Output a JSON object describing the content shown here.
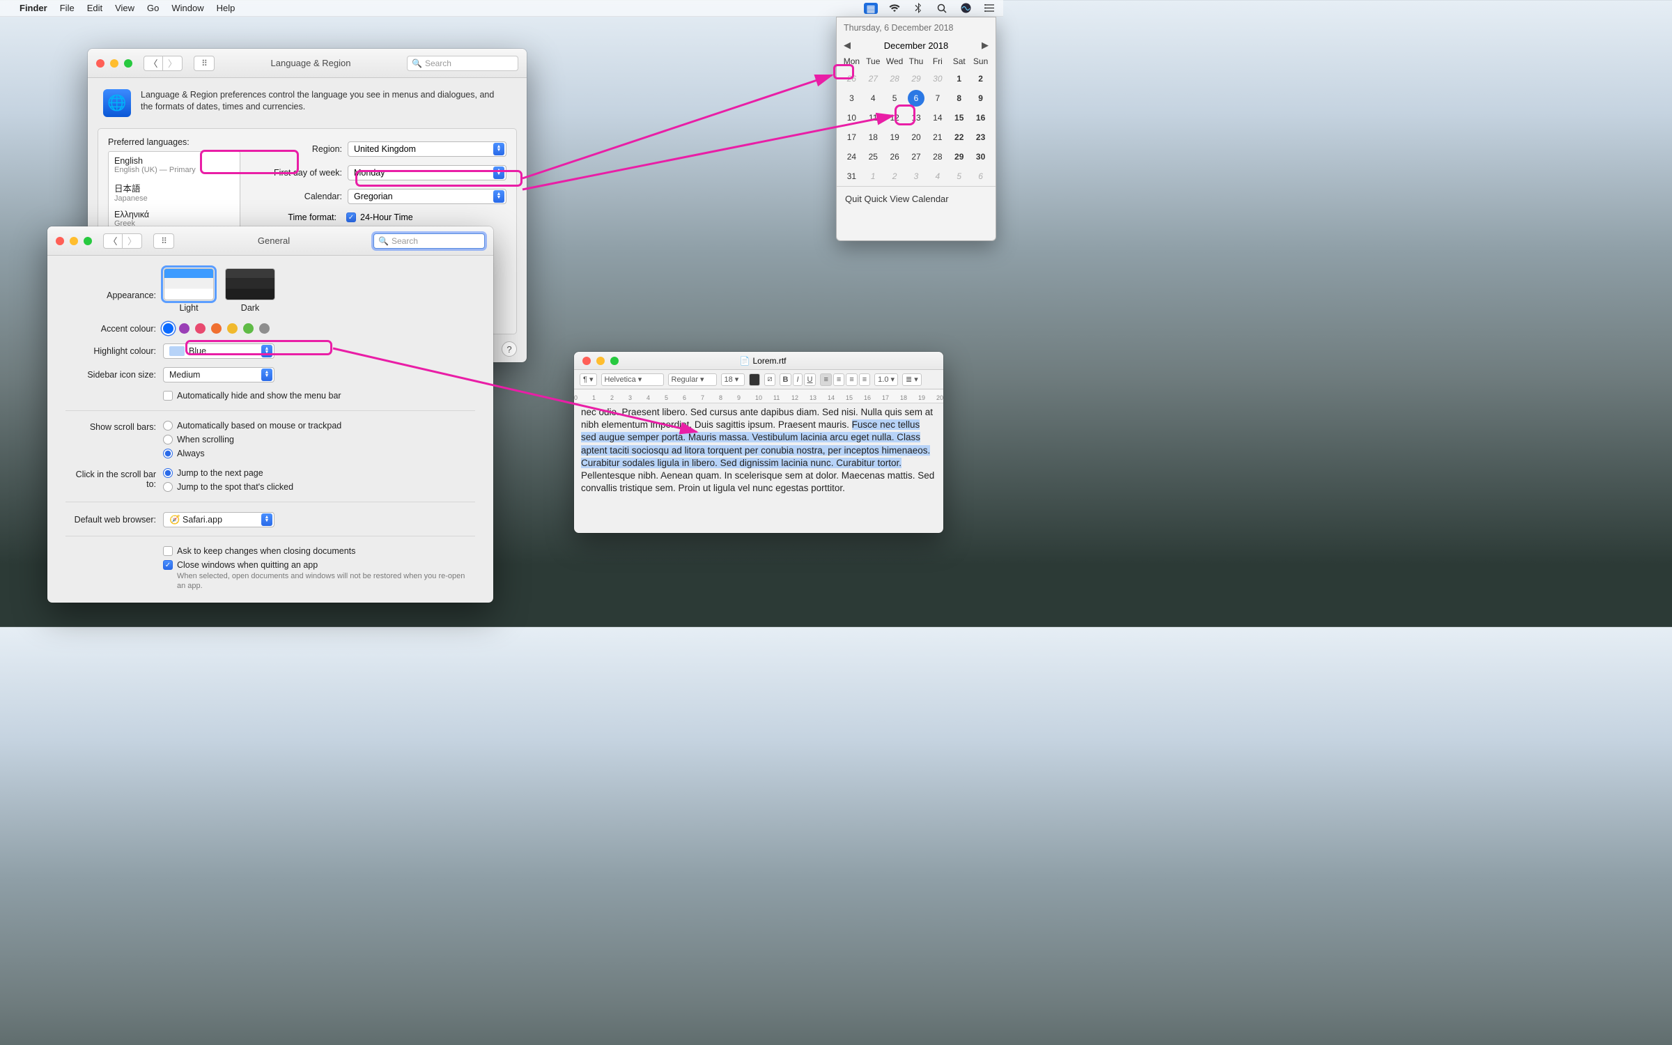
{
  "menubar": {
    "app": "Finder",
    "items": [
      "File",
      "Edit",
      "View",
      "Go",
      "Window",
      "Help"
    ]
  },
  "lang_region": {
    "title": "Language & Region",
    "search_placeholder": "Search",
    "intro": "Language & Region preferences control the language you see in menus and dialogues, and the formats of dates, times and currencies.",
    "preferred_label": "Preferred languages:",
    "languages": [
      {
        "maj": "English",
        "min": "English (UK) — Primary"
      },
      {
        "maj": "日本語",
        "min": "Japanese"
      },
      {
        "maj": "Ελληνικά",
        "min": "Greek"
      }
    ],
    "region_label": "Region:",
    "region_value": "United Kingdom",
    "firstday_label": "First day of week:",
    "firstday_value": "Monday",
    "calendar_label": "Calendar:",
    "calendar_value": "Gregorian",
    "timefmt_label": "Time format:",
    "timefmt_value": "24-Hour Time"
  },
  "general": {
    "title": "General",
    "search_placeholder": "Search",
    "appearance_label": "Appearance:",
    "appearance_light": "Light",
    "appearance_dark": "Dark",
    "accent_label": "Accent colour:",
    "accent_colors": [
      "#0a6aff",
      "#9a3fb6",
      "#e84a6f",
      "#f07030",
      "#f0b92d",
      "#5fbb46",
      "#8e8e8e"
    ],
    "highlight_label": "Highlight colour:",
    "highlight_value": "Blue",
    "highlight_swatch": "#b7d3f8",
    "sidebar_label": "Sidebar icon size:",
    "sidebar_value": "Medium",
    "hide_menu": "Automatically hide and show the menu bar",
    "scroll_label": "Show scroll bars:",
    "scroll_opts": [
      "Automatically based on mouse or trackpad",
      "When scrolling",
      "Always"
    ],
    "scroll_selected": 2,
    "click_label": "Click in the scroll bar to:",
    "click_opts": [
      "Jump to the next page",
      "Jump to the spot that's clicked"
    ],
    "click_selected": 0,
    "browser_label": "Default web browser:",
    "browser_value": "Safari.app",
    "ask_changes": "Ask to keep changes when closing documents",
    "close_windows": "Close windows when quitting an app",
    "close_windows_note": "When selected, open documents and windows will not be restored when you re-open an app."
  },
  "calendar": {
    "long_date": "Thursday, 6 December 2018",
    "month": "December 2018",
    "days": [
      "Mon",
      "Tue",
      "Wed",
      "Thu",
      "Fri",
      "Sat",
      "Sun"
    ],
    "weeks": [
      [
        {
          "n": "26",
          "o": true
        },
        {
          "n": "27",
          "o": true
        },
        {
          "n": "28",
          "o": true
        },
        {
          "n": "29",
          "o": true
        },
        {
          "n": "30",
          "o": true
        },
        {
          "n": "1",
          "we": true
        },
        {
          "n": "2",
          "we": true
        }
      ],
      [
        {
          "n": "3"
        },
        {
          "n": "4"
        },
        {
          "n": "5"
        },
        {
          "n": "6",
          "today": true
        },
        {
          "n": "7"
        },
        {
          "n": "8",
          "we": true
        },
        {
          "n": "9",
          "we": true
        }
      ],
      [
        {
          "n": "10"
        },
        {
          "n": "11"
        },
        {
          "n": "12"
        },
        {
          "n": "13"
        },
        {
          "n": "14"
        },
        {
          "n": "15",
          "we": true
        },
        {
          "n": "16",
          "we": true
        }
      ],
      [
        {
          "n": "17"
        },
        {
          "n": "18"
        },
        {
          "n": "19"
        },
        {
          "n": "20"
        },
        {
          "n": "21"
        },
        {
          "n": "22",
          "we": true
        },
        {
          "n": "23",
          "we": true
        }
      ],
      [
        {
          "n": "24"
        },
        {
          "n": "25"
        },
        {
          "n": "26"
        },
        {
          "n": "27"
        },
        {
          "n": "28"
        },
        {
          "n": "29",
          "we": true
        },
        {
          "n": "30",
          "we": true
        }
      ],
      [
        {
          "n": "31"
        },
        {
          "n": "1",
          "o": true
        },
        {
          "n": "2",
          "o": true
        },
        {
          "n": "3",
          "o": true
        },
        {
          "n": "4",
          "o": true
        },
        {
          "n": "5",
          "o": true
        },
        {
          "n": "6",
          "o": true
        }
      ]
    ],
    "quit": "Quit Quick View Calendar"
  },
  "textedit": {
    "filename": "Lorem.rtf",
    "font": "Helvetica",
    "style": "Regular",
    "size": "18",
    "spacing": "1.0",
    "pre": "nec odio. Praesent libero. Sed cursus ante dapibus diam. Sed nisi. Nulla quis sem at nibh elementum imperdiet. Duis sagittis ipsum. Praesent mauris. ",
    "sel": "Fusce nec tellus sed augue semper porta. Mauris massa. Vestibulum lacinia arcu eget nulla. Class aptent taciti sociosqu ad litora torquent per conubia nostra, per inceptos himenaeos. Curabitur sodales ligula in libero. Sed dignissim lacinia nunc. Curabitur tortor.",
    "post": " Pellentesque nibh. Aenean quam. In scelerisque sem at dolor. Maecenas mattis. Sed convallis tristique sem. Proin ut ligula vel nunc egestas porttitor."
  }
}
